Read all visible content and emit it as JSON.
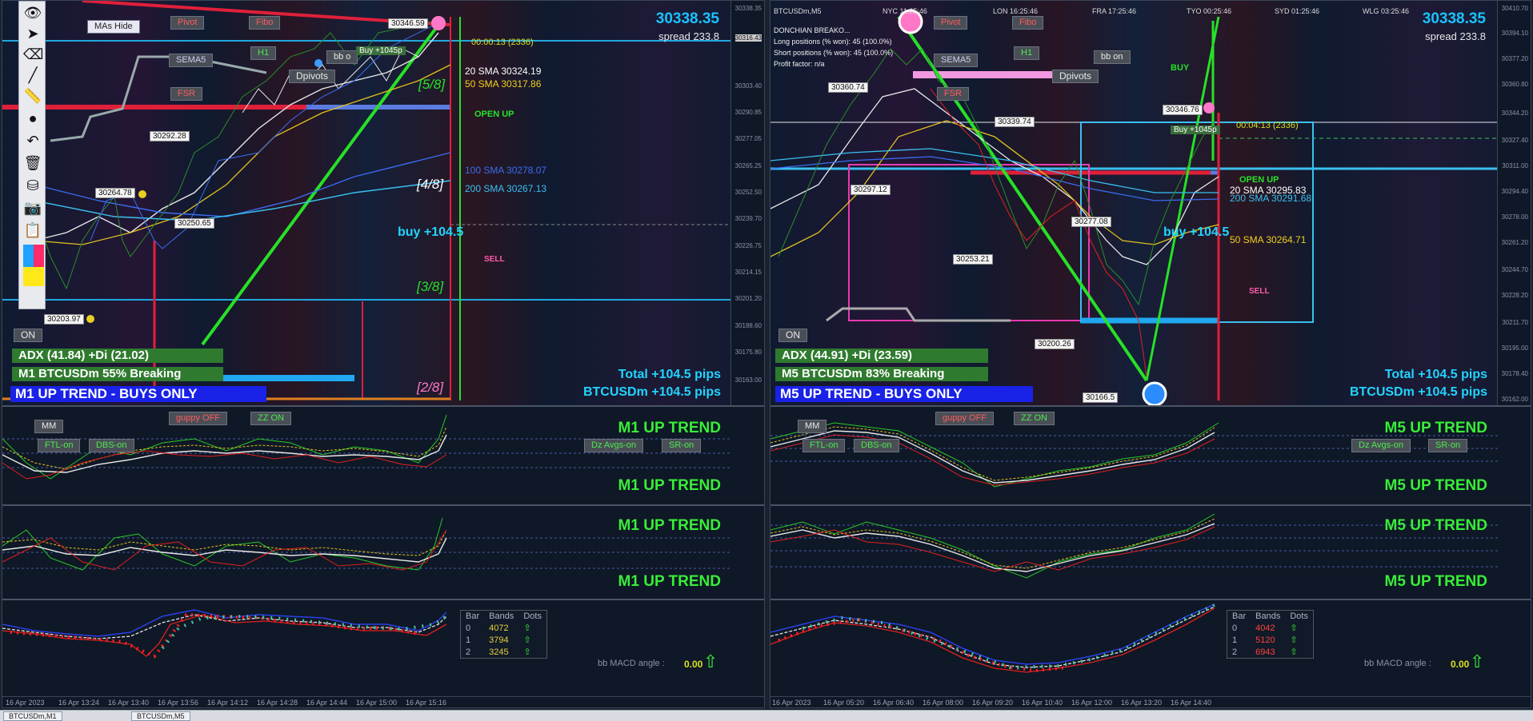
{
  "left": {
    "price": "30338.35",
    "spread": "spread 233.8",
    "buttons": {
      "mas_hide": "MAs Hide",
      "pivot": "Pivot",
      "fibo": "Fibo",
      "sema": "SEMA5",
      "h1": "H1",
      "bb": "bb o",
      "dpivots": "Dpivots",
      "fsr": "FSR",
      "on": "ON",
      "mm": "MM",
      "guppy": "guppy OFF",
      "zz": "ZZ ON",
      "ftl": "FTL-on",
      "dbs": "DBS-on",
      "dz": "Dz Avgs-on",
      "sr": "SR-on"
    },
    "buy_badge": "Buy +1045p",
    "timer": "00:00:13 (2336)",
    "open_up": "OPEN UP",
    "buy_label": "buy +104.5",
    "sell_label": "SELL",
    "sma20": "20 SMA 30324.19",
    "sma50": "50 SMA 30317.86",
    "sma100": "100 SMA 30278.07",
    "sma200": "200 SMA 30267.13",
    "levels": {
      "l58": "[5/8]",
      "l48": "[4/8]",
      "l38": "[3/8]",
      "l28": "[2/8]"
    },
    "price_tags": [
      "30346.59",
      "30292.28",
      "30264.78",
      "30250.65",
      "30203.97"
    ],
    "adx": "ADX (41.84)  +Di (21.02)",
    "breaking": "M1 BTCUSDm 55% Breaking",
    "trend_banner": "M1 UP TREND - BUYS ONLY",
    "total_pips": "Total +104.5 pips",
    "symbol_pips": "BTCUSDm +104.5 pips",
    "sub_trend": "M1 UP TREND",
    "table": {
      "headers": [
        "Bar",
        "Bands",
        "Dots"
      ],
      "rows": [
        [
          "0",
          "4072"
        ],
        [
          "1",
          "3794"
        ],
        [
          "2",
          "3245"
        ]
      ]
    },
    "macd_label": "bb MACD angle :",
    "macd_value": "0.00",
    "axis": [
      "30338.35",
      "30316.43",
      "30303.40",
      "30290.85",
      "30277.05",
      "30265.25",
      "30252.50",
      "30239.70",
      "30226.75",
      "30214.15",
      "30201.20",
      "30188.60",
      "30175.80",
      "30163.00"
    ],
    "times": [
      "16 Apr 2023",
      "16 Apr 13:24",
      "16 Apr 13:40",
      "16 Apr 13:56",
      "16 Apr 14:12",
      "16 Apr 14:28",
      "16 Apr 14:44",
      "16 Apr 15:00",
      "16 Apr 15:16"
    ]
  },
  "right": {
    "title": "BTCUSDm,M5",
    "sessions": [
      "NYC 11:25:46",
      "LON 16:25:46",
      "FRA 17:25:46",
      "TYO 00:25:46",
      "SYD 01:25:46",
      "WLG 03:25:46"
    ],
    "info": [
      "DONCHIAN BREAKO...",
      "Long positions (% won): 45 (100.0%)",
      "Short positions (% won): 45 (100.0%)",
      "Profit factor: n/a"
    ],
    "price": "30338.35",
    "spread": "spread 233.8",
    "buttons": {
      "pivot": "Pivot",
      "fibo": "Fibo",
      "sema": "SEMA5",
      "h1": "H1",
      "bb": "bb on",
      "dpivots": "Dpivots",
      "fsr": "FSR",
      "on": "ON",
      "mm": "MM",
      "guppy": "guppy OFF",
      "zz": "ZZ ON",
      "ftl": "FTL-on",
      "dbs": "DBS-on",
      "dz": "Dz Avgs-on",
      "sr": "SR-on"
    },
    "buy_badge": "Buy +1045p",
    "timer": "00:04:13 (2336)",
    "open_up": "OPEN UP",
    "buy_top": "BUY",
    "buy_label": "buy +104.5",
    "sell_label": "SELL",
    "sma20": "20 SMA 30295.83",
    "sma200": "200 SMA 30291.68",
    "sma50": "50 SMA 30264.71",
    "price_tags": [
      "30360.74",
      "30346.76",
      "30339.74",
      "30297.12",
      "30277.08",
      "30253.21",
      "30200.26",
      "30166.5"
    ],
    "adx": "ADX (44.91)  +Di (23.59)",
    "breaking": "M5 BTCUSDm 83% Breaking",
    "trend_banner": "M5 UP TREND - BUYS ONLY",
    "total_pips": "Total +104.5 pips",
    "symbol_pips": "BTCUSDm +104.5 pips",
    "sub_trend": "M5 UP TREND",
    "table": {
      "headers": [
        "Bar",
        "Bands",
        "Dots"
      ],
      "rows": [
        [
          "0",
          "4042"
        ],
        [
          "1",
          "5120"
        ],
        [
          "2",
          "6943"
        ]
      ]
    },
    "macd_label": "bb MACD angle :",
    "macd_value": "0.00",
    "axis": [
      "30410.70",
      "30394.10",
      "30377.20",
      "30360.80",
      "30344.20",
      "30327.40",
      "30311.00",
      "30294.40",
      "30278.00",
      "30261.20",
      "30244.70",
      "30228.20",
      "30211.70",
      "30195.00",
      "30178.40",
      "30162.00"
    ],
    "times": [
      "16 Apr 2023",
      "16 Apr 05:20",
      "16 Apr 06:40",
      "16 Apr 08:00",
      "16 Apr 09:20",
      "16 Apr 10:40",
      "16 Apr 12:00",
      "16 Apr 13:20",
      "16 Apr 14:40"
    ]
  },
  "taskbar": [
    "BTCUSDm,M1",
    "BTCUSDm,M5"
  ]
}
